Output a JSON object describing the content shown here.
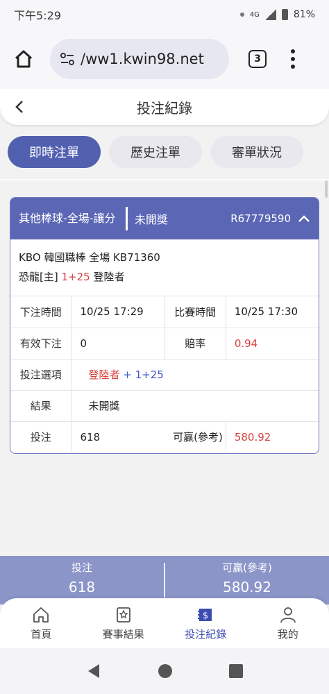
{
  "status_bar": {
    "time": "下午5:29",
    "network": "4G",
    "battery": "81%"
  },
  "browser": {
    "url": "/ww1.kwin98.net",
    "tab_count": "3"
  },
  "header": {
    "title": "投注紀錄"
  },
  "tabs": [
    {
      "label": "即時注單",
      "active": true
    },
    {
      "label": "歷史注單",
      "active": false
    },
    {
      "label": "審單狀況",
      "active": false
    }
  ],
  "bet": {
    "league": "其他棒球-全場-讓分",
    "status": "未開獎",
    "order_no": "R67779590",
    "match_line1": "KBO 韓國職棒 全場 KB71360",
    "team": "恐龍[主]",
    "handicap": "1+25",
    "opponent": "登陸者",
    "bet_time_label": "下注時間",
    "bet_time": "10/25 17:29",
    "match_time_label": "比賽時間",
    "match_time": "10/25 17:30",
    "valid_bet_label": "有效下注",
    "valid_bet": "0",
    "odds_label": "賠率",
    "odds": "0.94",
    "selection_label": "投注選項",
    "selection_team": "登陸者",
    "selection_handicap": "+ 1+25",
    "result_label": "結果",
    "result": "未開獎",
    "stake_label": "投注",
    "stake": "618",
    "win_label": "可贏(參考)",
    "win": "580.92"
  },
  "summary": {
    "stake_label": "投注",
    "stake": "618",
    "win_label": "可贏(參考)",
    "win": "580.92"
  },
  "bottom_nav": [
    {
      "label": "首頁",
      "icon": "home-icon",
      "active": false
    },
    {
      "label": "賽事結果",
      "icon": "results-icon",
      "active": false
    },
    {
      "label": "投注紀錄",
      "icon": "bet-record-icon",
      "active": true
    },
    {
      "label": "我的",
      "icon": "profile-icon",
      "active": false
    }
  ],
  "colors": {
    "accent": "#5260b0",
    "highlight": "#d8413f",
    "link": "#3a56c8"
  }
}
